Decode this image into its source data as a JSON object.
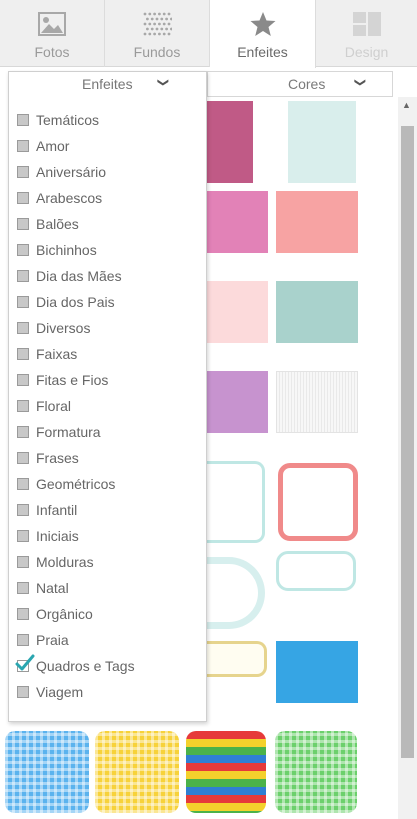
{
  "tabs": [
    {
      "label": "Fotos",
      "icon": "image-icon",
      "state": "normal"
    },
    {
      "label": "Fundos",
      "icon": "dot-pattern-icon",
      "state": "normal"
    },
    {
      "label": "Enfeites",
      "icon": "star-icon",
      "state": "active"
    },
    {
      "label": "Design",
      "icon": "layout-icon",
      "state": "disabled"
    }
  ],
  "filters": {
    "category": {
      "selected": "Enfeites",
      "icon": "chevron-down-icon"
    },
    "color": {
      "selected": "Cores",
      "icon": "chevron-down-icon"
    }
  },
  "category_menu": {
    "options": [
      {
        "label": "Temáticos",
        "checked": false
      },
      {
        "label": "Amor",
        "checked": false
      },
      {
        "label": "Aniversário",
        "checked": false
      },
      {
        "label": "Arabescos",
        "checked": false
      },
      {
        "label": "Balões",
        "checked": false
      },
      {
        "label": "Bichinhos",
        "checked": false
      },
      {
        "label": "Dia das Mães",
        "checked": false
      },
      {
        "label": "Dia dos Pais",
        "checked": false
      },
      {
        "label": "Diversos",
        "checked": false
      },
      {
        "label": "Faixas",
        "checked": false
      },
      {
        "label": "Fitas e Fios",
        "checked": false
      },
      {
        "label": "Floral",
        "checked": false
      },
      {
        "label": "Formatura",
        "checked": false
      },
      {
        "label": "Frases",
        "checked": false
      },
      {
        "label": "Geométricos",
        "checked": false
      },
      {
        "label": "Infantil",
        "checked": false
      },
      {
        "label": "Iniciais",
        "checked": false
      },
      {
        "label": "Molduras",
        "checked": false
      },
      {
        "label": "Natal",
        "checked": false
      },
      {
        "label": "Orgânico",
        "checked": false
      },
      {
        "label": "Praia",
        "checked": false
      },
      {
        "label": "Quadros e Tags",
        "checked": true
      },
      {
        "label": "Viagem",
        "checked": false
      }
    ]
  },
  "palette": {
    "accent": "#2aa6b0",
    "tab_bg": "#efefef",
    "tile_colors": {
      "pink_paper": "#c05a86",
      "mint_paper": "#d9eeec",
      "pink": "#e282b7",
      "coral": "#f7a3a3",
      "blush": "#fcdadb",
      "sage": "#a9d2cc",
      "lilac": "#c793cf",
      "white": "#f6f6f6",
      "frame_mint": "#bfe7e4",
      "frame_coral": "#f08a8a",
      "frame_yellow": "#e6d48d",
      "blue": "#36a5e4",
      "gingham_blue": "#5bb3ee",
      "gingham_yellow": "#f7d23a",
      "gingham_green": "#6cd06c"
    }
  }
}
